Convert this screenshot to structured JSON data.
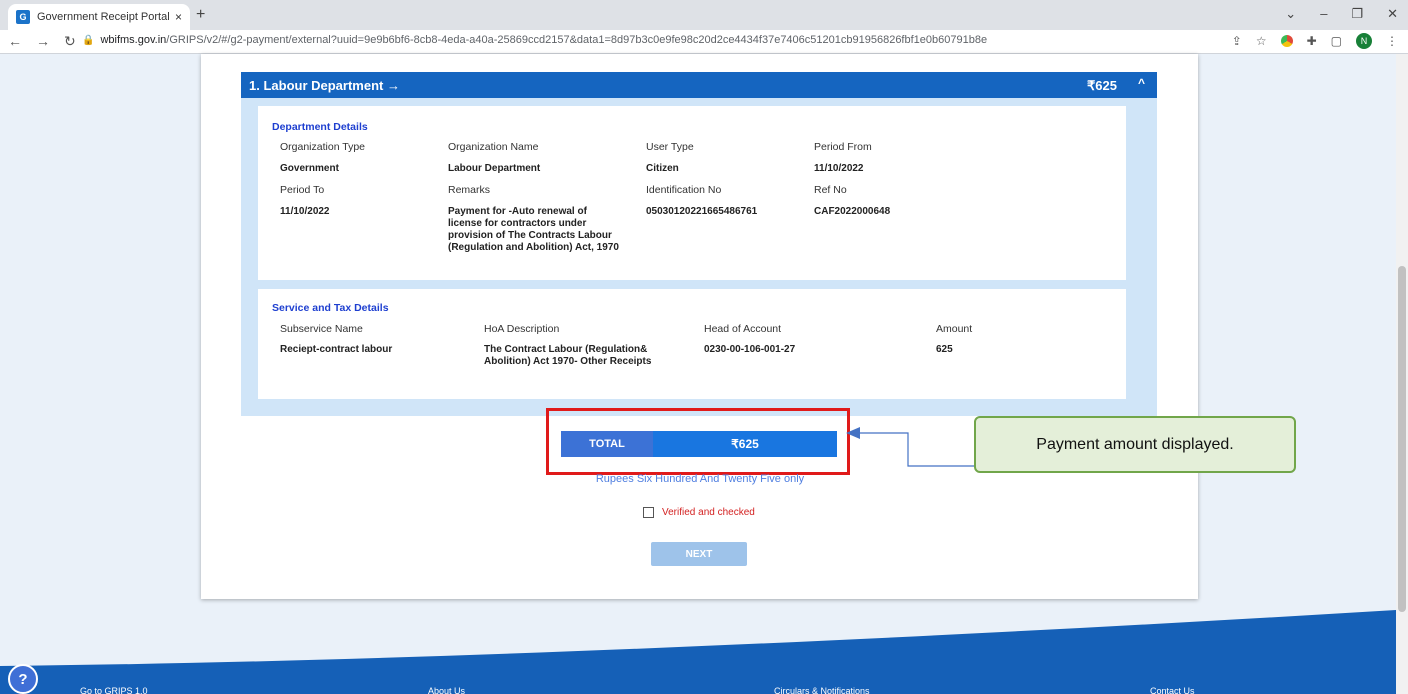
{
  "browser": {
    "tab_title": "Government Receipt Portal Syste",
    "tab_favicon": "G",
    "tab_close": "×",
    "new_tab": "+",
    "url_host": "wbifms.gov.in",
    "url_path": "/GRIPS/v2/#/g2-payment/external?uuid=9e9b6bf6-8cb8-4eda-a40a-25869ccd2157&data1=8d97b3c0e9fe98c20d2ce4434f37e7406c51201cb91956826fbf1e0b60791b8e",
    "profile_initial": "N"
  },
  "department": {
    "title": "1. Labour Department →",
    "amount": "₹625",
    "details_title": "Department Details",
    "org_type_label": "Organization Type",
    "org_name_label": "Organization Name",
    "user_type_label": "User Type",
    "period_from_label": "Period From",
    "org_type": "Government",
    "org_name": "Labour Department",
    "user_type": "Citizen",
    "period_from": "11/10/2022",
    "period_to_label": "Period To",
    "remarks_label": "Remarks",
    "ident_label": "Identification No",
    "ref_label": "Ref No",
    "period_to": "11/10/2022",
    "remarks_l1": "Payment for -Auto renewal of",
    "remarks_l2": "license for contractors under",
    "remarks_l3": "provision of The Contracts Labour",
    "remarks_l4": "(Regulation and Abolition) Act, 1970",
    "ident_no": "05030120221665486761",
    "ref_no": "CAF2022000648"
  },
  "service": {
    "title": "Service and Tax Details",
    "subservice_label": "Subservice Name",
    "hoa_label": "HoA Description",
    "head_label": "Head of Account",
    "amount_label": "Amount",
    "subservice": "Reciept-contract labour",
    "hoa_l1": "The Contract Labour (Regulation&",
    "hoa_l2": "Abolition) Act 1970- Other Receipts",
    "head": "0230-00-106-001-27",
    "amount": "625"
  },
  "total": {
    "label": "TOTAL",
    "value": "₹625",
    "words": "Rupees Six Hundred And Twenty Five only"
  },
  "verify_label": "Verified and checked",
  "next_label": "NEXT",
  "callout": "Payment amount displayed.",
  "footer": {
    "grips": "Go to GRIPS 1.0",
    "about": "About Us",
    "circulars": "Circulars & Notifications",
    "contact": "Contact Us"
  },
  "colors": {
    "header_blue": "#1565c0",
    "panel_bg": "#d0e5f8",
    "highlight_red": "#e01a1a",
    "callout_green": "#71a64a",
    "footer_blue": "#1560b7"
  }
}
